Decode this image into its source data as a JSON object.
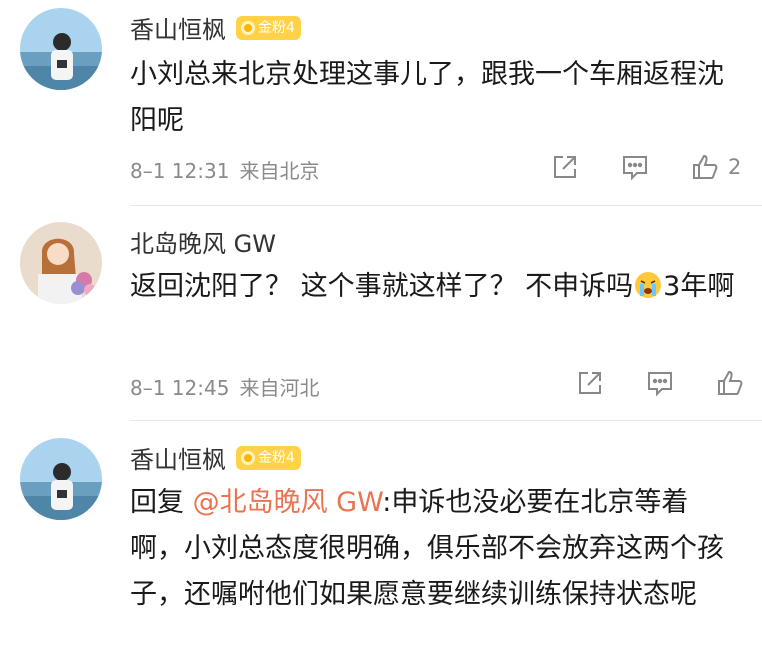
{
  "comments": [
    {
      "username": "香山恒枫",
      "badge": "金粉4",
      "text": "小刘总来北京处理这事儿了，跟我一个车厢返程沈阳呢",
      "time": "8–1 12:31",
      "location": "来自北京",
      "like_count": "2"
    },
    {
      "username": "北岛晚风 GW",
      "text_before_emoji": "返回沈阳了？ 这个事就这样了？ 不申诉吗",
      "emoji": "crying-face",
      "text_after_emoji": "3年啊",
      "time": "8–1 12:45",
      "location": "来自河北"
    },
    {
      "username": "香山恒枫",
      "badge": "金粉4",
      "reply_prefix": "回复 ",
      "mention": "@北岛晚风 GW",
      "text": ":申诉也没必要在北京等着啊，小刘总态度很明确，俱乐部不会放弃这两个孩子，还嘱咐他们如果愿意要继续训练保持状态呢"
    }
  ],
  "colors": {
    "badge": "#ffd248",
    "mention": "#eb7350",
    "meta": "#8a8a8a"
  },
  "icons": {
    "share": "share-icon",
    "comment": "comment-icon",
    "like": "thumbs-up-icon"
  }
}
